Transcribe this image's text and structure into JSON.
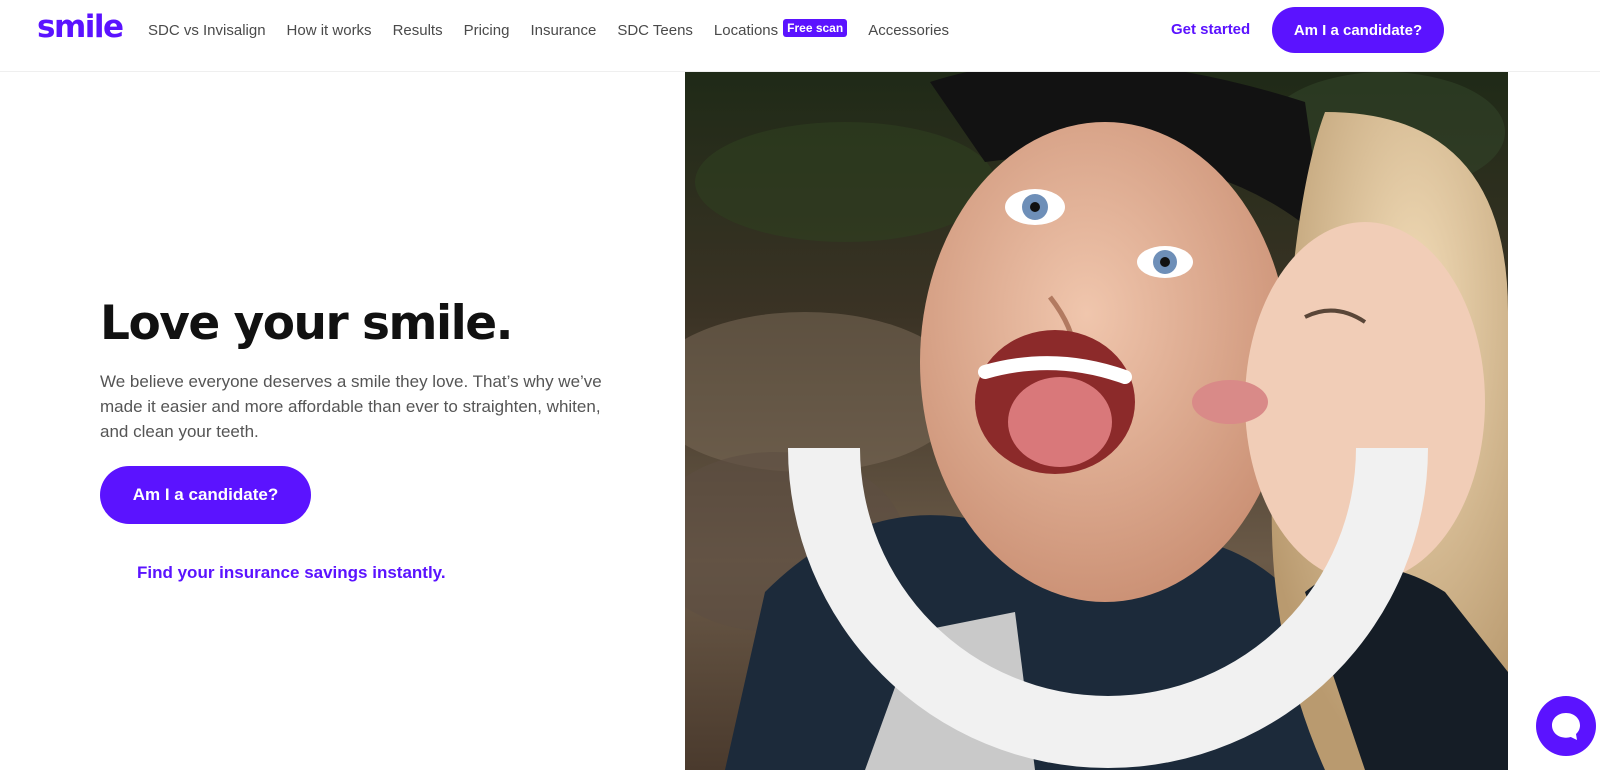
{
  "header": {
    "logo": "smile",
    "nav": [
      {
        "label": "SDC vs Invisalign"
      },
      {
        "label": "How it works"
      },
      {
        "label": "Results"
      },
      {
        "label": "Pricing"
      },
      {
        "label": "Insurance"
      },
      {
        "label": "SDC Teens"
      },
      {
        "label": "Locations",
        "badge": "Free scan"
      },
      {
        "label": "Accessories"
      }
    ],
    "get_started": "Get started",
    "cta": "Am I a candidate?"
  },
  "hero": {
    "title": "Love your smile.",
    "text": "We believe everyone deserves a smile they love. That’s why we’ve made it easier and more affordable than ever to straighten, whiten, and clean your teeth.",
    "cta": "Am I a candidate?",
    "insurance_link": "Find your insurance savings instantly."
  },
  "icons": {
    "chat": "chat-bubble-icon"
  },
  "colors": {
    "brand": "#5b13ff",
    "text_dark": "#111111",
    "text_body": "#555555"
  }
}
